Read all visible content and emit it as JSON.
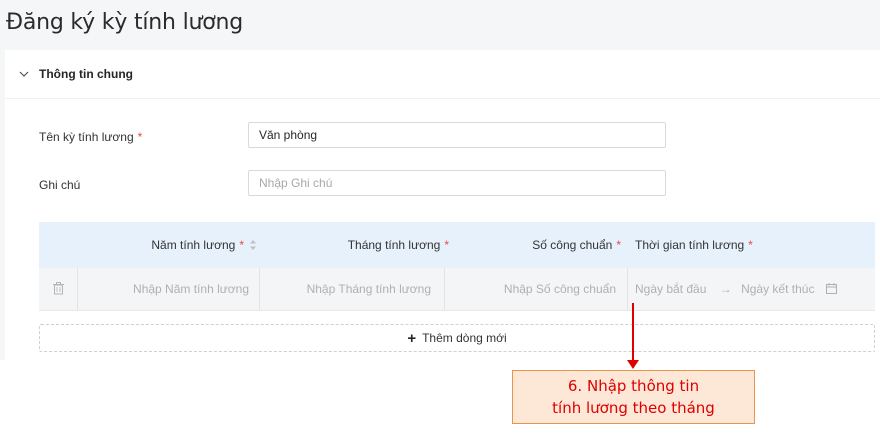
{
  "page": {
    "title": "Đăng ký kỳ tính lương"
  },
  "section": {
    "title": "Thông tin chung"
  },
  "form": {
    "name_label": "Tên kỳ tính lương",
    "name_value": "Văn phòng",
    "note_label": "Ghi chú",
    "note_placeholder": "Nhập Ghi chú",
    "required_mark": "*"
  },
  "table": {
    "headers": {
      "year": "Năm tính lương",
      "month": "Tháng tính lương",
      "days": "Số công chuẩn",
      "period": "Thời gian tính lương"
    },
    "row": {
      "year_placeholder": "Nhập Năm tính lương",
      "month_placeholder": "Nhập Tháng tính lương",
      "days_placeholder": "Nhập Số công chuẩn",
      "start_placeholder": "Ngày bắt đầu",
      "range_separator": "→",
      "end_placeholder": "Ngày kết thúc"
    },
    "add_row_label": "Thêm dòng mới"
  },
  "annotation": {
    "line1": "6. Nhập thông tin",
    "line2": "tính lương theo tháng"
  },
  "colors": {
    "required": "#e5484d",
    "header_bg": "#e6f1fc",
    "annotation": "#e00000",
    "callout_bg": "#fde7d6"
  }
}
